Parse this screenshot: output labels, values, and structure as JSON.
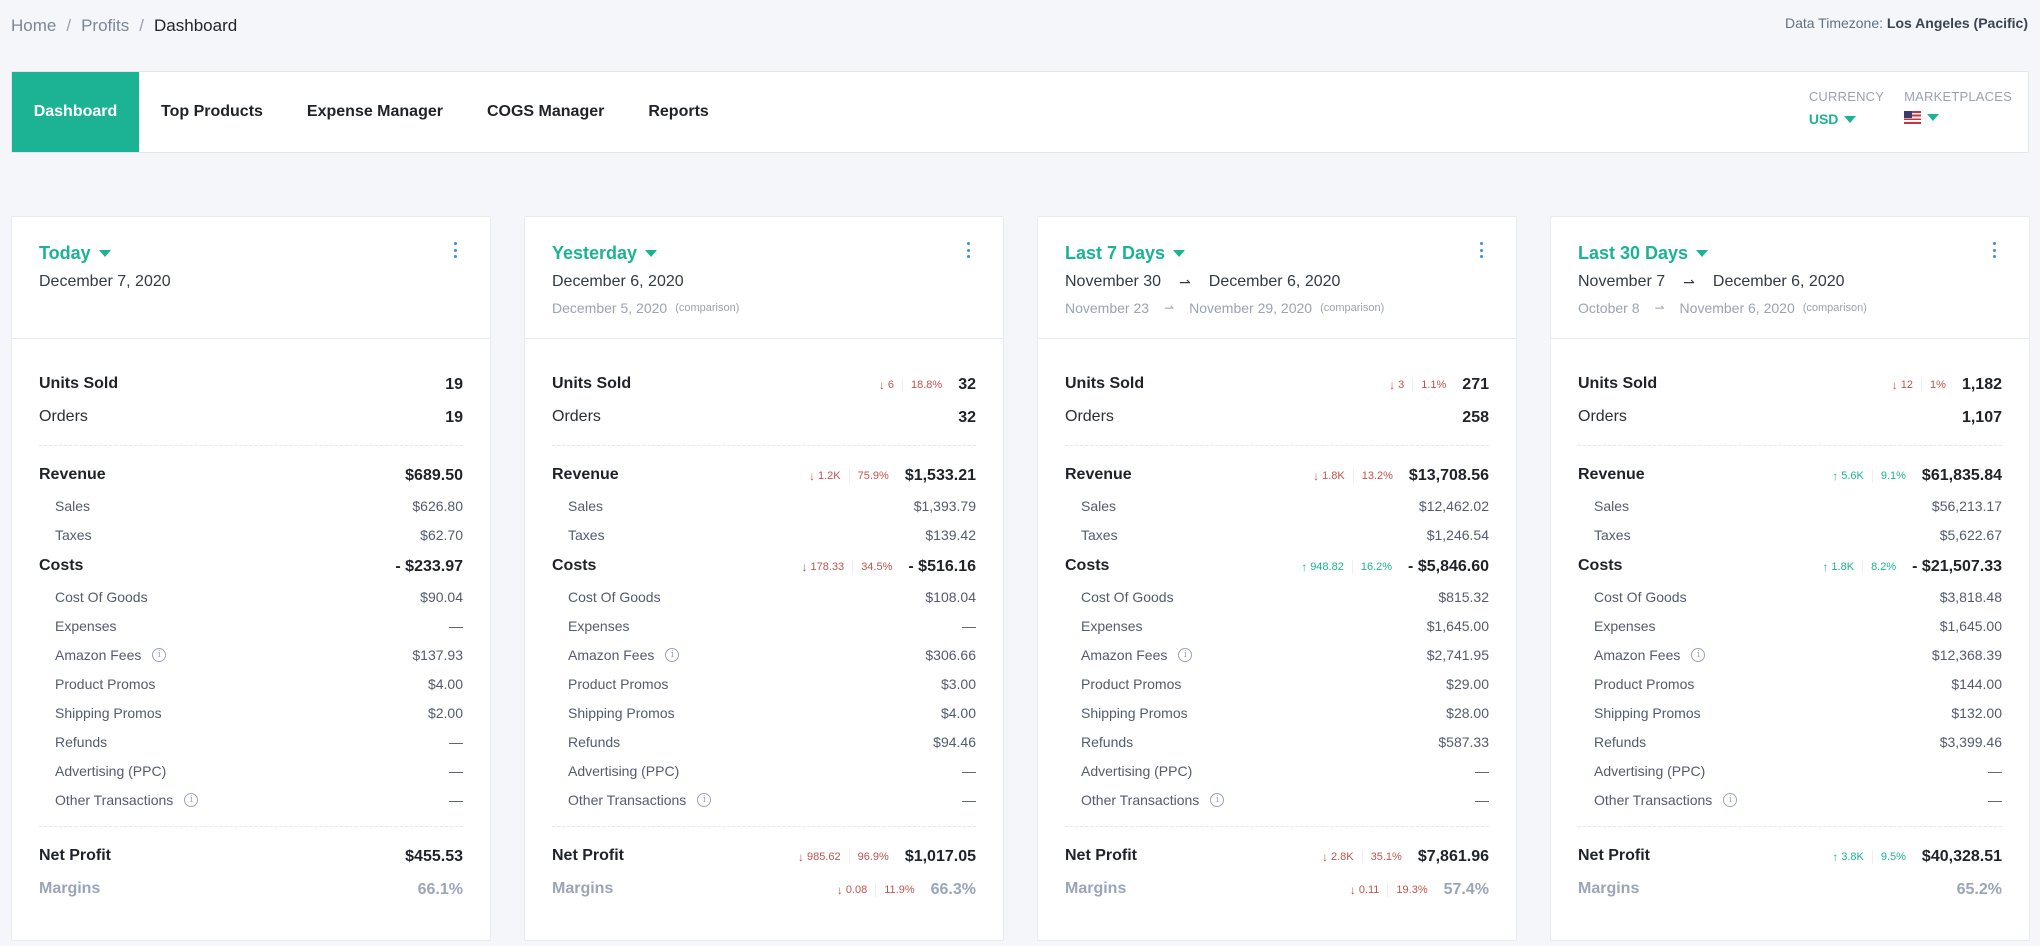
{
  "breadcrumb": [
    "Home",
    "Profits",
    "Dashboard"
  ],
  "timezone": {
    "label": "Data Timezone:",
    "value": "Los Angeles (Pacific)"
  },
  "nav": {
    "tabs": [
      {
        "label": "Dashboard",
        "active": true
      },
      {
        "label": "Top Products",
        "active": false
      },
      {
        "label": "Expense Manager",
        "active": false
      },
      {
        "label": "COGS Manager",
        "active": false
      },
      {
        "label": "Reports",
        "active": false
      }
    ],
    "currency": {
      "label": "CURRENCY",
      "value": "USD"
    },
    "marketplaces": {
      "label": "MARKETPLACES",
      "value": "us-flag-icon"
    }
  },
  "colors": {
    "accent": "#1cb394",
    "negative": "#c05450",
    "kebab": "#3a8ee6"
  },
  "comparison_tag": "(comparison)",
  "row_labels": {
    "units_sold": "Units Sold",
    "orders": "Orders",
    "revenue": "Revenue",
    "sales": "Sales",
    "taxes": "Taxes",
    "costs": "Costs",
    "cogs": "Cost Of Goods",
    "expenses": "Expenses",
    "amazon_fees": "Amazon Fees",
    "product_promos": "Product Promos",
    "shipping_promos": "Shipping Promos",
    "refunds": "Refunds",
    "advertising": "Advertising (PPC)",
    "other": "Other Transactions",
    "net_profit": "Net Profit",
    "margins": "Margins"
  },
  "cards": [
    {
      "period": "Today",
      "range_start": "December 7, 2020",
      "range_end": null,
      "cmp_start": null,
      "cmp_end": null,
      "units_sold": "19",
      "orders": "19",
      "revenue": "$689.50",
      "sales": "$626.80",
      "taxes": "$62.70",
      "costs": "- $233.97",
      "cogs": "$90.04",
      "expenses": "—",
      "amazon_fees": "$137.93",
      "product_promos": "$4.00",
      "shipping_promos": "$2.00",
      "refunds": "—",
      "advertising": "—",
      "other": "—",
      "net_profit": "$455.53",
      "margins": "66.1%",
      "deltas": {}
    },
    {
      "period": "Yesterday",
      "range_start": "December 6, 2020",
      "range_end": null,
      "cmp_start": "December 5, 2020",
      "cmp_end": null,
      "units_sold": "32",
      "orders": "32",
      "revenue": "$1,533.21",
      "sales": "$1,393.79",
      "taxes": "$139.42",
      "costs": "- $516.16",
      "cogs": "$108.04",
      "expenses": "—",
      "amazon_fees": "$306.66",
      "product_promos": "$3.00",
      "shipping_promos": "$4.00",
      "refunds": "$94.46",
      "advertising": "—",
      "other": "—",
      "net_profit": "$1,017.05",
      "margins": "66.3%",
      "deltas": {
        "units_sold": {
          "dir": "down",
          "amount": "6",
          "percent": "18.8%"
        },
        "revenue": {
          "dir": "down",
          "amount": "1.2K",
          "percent": "75.9%"
        },
        "costs": {
          "dir": "down",
          "amount": "178.33",
          "percent": "34.5%"
        },
        "net_profit": {
          "dir": "down",
          "amount": "985.62",
          "percent": "96.9%"
        },
        "margins": {
          "dir": "down",
          "amount": "0.08",
          "percent": "11.9%"
        }
      }
    },
    {
      "period": "Last 7 Days",
      "range_start": "November 30",
      "range_end": "December 6, 2020",
      "cmp_start": "November 23",
      "cmp_end": "November 29, 2020",
      "units_sold": "271",
      "orders": "258",
      "revenue": "$13,708.56",
      "sales": "$12,462.02",
      "taxes": "$1,246.54",
      "costs": "- $5,846.60",
      "cogs": "$815.32",
      "expenses": "$1,645.00",
      "amazon_fees": "$2,741.95",
      "product_promos": "$29.00",
      "shipping_promos": "$28.00",
      "refunds": "$587.33",
      "advertising": "—",
      "other": "—",
      "net_profit": "$7,861.96",
      "margins": "57.4%",
      "deltas": {
        "units_sold": {
          "dir": "down",
          "amount": "3",
          "percent": "1.1%"
        },
        "revenue": {
          "dir": "down",
          "amount": "1.8K",
          "percent": "13.2%"
        },
        "costs": {
          "dir": "up",
          "amount": "948.82",
          "percent": "16.2%"
        },
        "net_profit": {
          "dir": "down",
          "amount": "2.8K",
          "percent": "35.1%"
        },
        "margins": {
          "dir": "down",
          "amount": "0.11",
          "percent": "19.3%"
        }
      }
    },
    {
      "period": "Last 30 Days",
      "range_start": "November 7",
      "range_end": "December 6, 2020",
      "cmp_start": "October 8",
      "cmp_end": "November 6, 2020",
      "units_sold": "1,182",
      "orders": "1,107",
      "revenue": "$61,835.84",
      "sales": "$56,213.17",
      "taxes": "$5,622.67",
      "costs": "- $21,507.33",
      "cogs": "$3,818.48",
      "expenses": "$1,645.00",
      "amazon_fees": "$12,368.39",
      "product_promos": "$144.00",
      "shipping_promos": "$132.00",
      "refunds": "$3,399.46",
      "advertising": "—",
      "other": "—",
      "net_profit": "$40,328.51",
      "margins": "65.2%",
      "deltas": {
        "units_sold": {
          "dir": "down",
          "amount": "12",
          "percent": "1%"
        },
        "revenue": {
          "dir": "up",
          "amount": "5.6K",
          "percent": "9.1%"
        },
        "costs": {
          "dir": "up",
          "amount": "1.8K",
          "percent": "8.2%"
        },
        "net_profit": {
          "dir": "up",
          "amount": "3.8K",
          "percent": "9.5%"
        }
      }
    }
  ]
}
